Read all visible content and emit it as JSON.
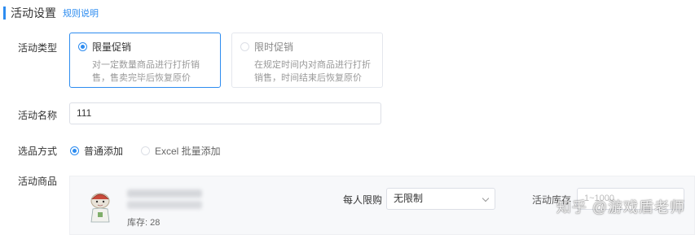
{
  "section": {
    "title": "活动设置",
    "rules_link": "规则说明"
  },
  "activity_type": {
    "label": "活动类型",
    "options": [
      {
        "title": "限量促销",
        "desc": "对一定数量商品进行打折销售，售卖完毕后恢复原价",
        "selected": true
      },
      {
        "title": "限时促销",
        "desc": "在规定时间内对商品进行打折销售，时间结束后恢复原价",
        "selected": false
      }
    ]
  },
  "activity_name": {
    "label": "活动名称",
    "value": "111"
  },
  "selection_method": {
    "label": "选品方式",
    "options": [
      {
        "label": "普通添加",
        "selected": true
      },
      {
        "label": "Excel 批量添加",
        "selected": false
      }
    ]
  },
  "activity_goods": {
    "label": "活动商品",
    "stock": "库存: 28",
    "per_person_limit_label": "每人限购",
    "per_person_limit_value": "无限制",
    "activity_stock_label": "活动库存",
    "activity_stock_placeholder": "1~1000"
  },
  "watermark": "知乎 @游戏盾老师"
}
